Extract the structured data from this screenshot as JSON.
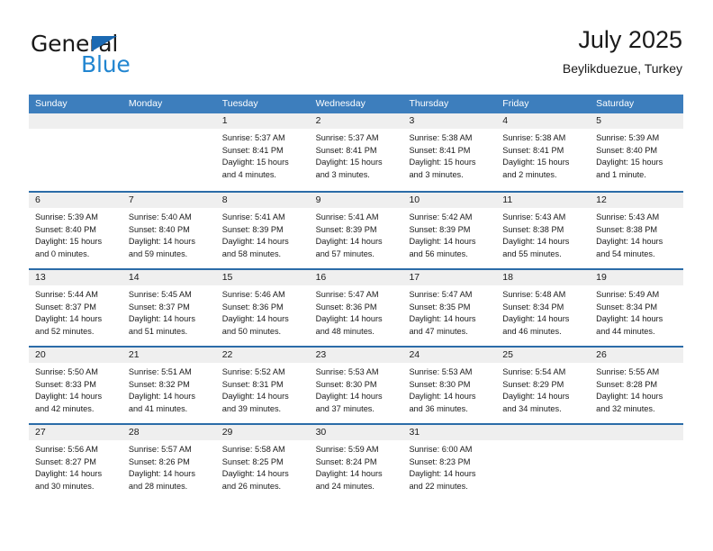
{
  "brand": {
    "name_part1": "General",
    "name_part2": "Blue",
    "accent_color": "#2185d0",
    "triangle_color": "#1b69b2"
  },
  "header": {
    "title": "July 2025",
    "subtitle": "Beylikduezue, Turkey"
  },
  "calendar": {
    "header_bg": "#3d7ebd",
    "row_divider": "#2b6ca8",
    "daynum_bg": "#efefef",
    "weekdays": [
      "Sunday",
      "Monday",
      "Tuesday",
      "Wednesday",
      "Thursday",
      "Friday",
      "Saturday"
    ],
    "weeks": [
      [
        {
          "day": "",
          "empty": true
        },
        {
          "day": "",
          "empty": true
        },
        {
          "day": "1",
          "sunrise": "Sunrise: 5:37 AM",
          "sunset": "Sunset: 8:41 PM",
          "daylight": "Daylight: 15 hours and 4 minutes."
        },
        {
          "day": "2",
          "sunrise": "Sunrise: 5:37 AM",
          "sunset": "Sunset: 8:41 PM",
          "daylight": "Daylight: 15 hours and 3 minutes."
        },
        {
          "day": "3",
          "sunrise": "Sunrise: 5:38 AM",
          "sunset": "Sunset: 8:41 PM",
          "daylight": "Daylight: 15 hours and 3 minutes."
        },
        {
          "day": "4",
          "sunrise": "Sunrise: 5:38 AM",
          "sunset": "Sunset: 8:41 PM",
          "daylight": "Daylight: 15 hours and 2 minutes."
        },
        {
          "day": "5",
          "sunrise": "Sunrise: 5:39 AM",
          "sunset": "Sunset: 8:40 PM",
          "daylight": "Daylight: 15 hours and 1 minute."
        }
      ],
      [
        {
          "day": "6",
          "sunrise": "Sunrise: 5:39 AM",
          "sunset": "Sunset: 8:40 PM",
          "daylight": "Daylight: 15 hours and 0 minutes."
        },
        {
          "day": "7",
          "sunrise": "Sunrise: 5:40 AM",
          "sunset": "Sunset: 8:40 PM",
          "daylight": "Daylight: 14 hours and 59 minutes."
        },
        {
          "day": "8",
          "sunrise": "Sunrise: 5:41 AM",
          "sunset": "Sunset: 8:39 PM",
          "daylight": "Daylight: 14 hours and 58 minutes."
        },
        {
          "day": "9",
          "sunrise": "Sunrise: 5:41 AM",
          "sunset": "Sunset: 8:39 PM",
          "daylight": "Daylight: 14 hours and 57 minutes."
        },
        {
          "day": "10",
          "sunrise": "Sunrise: 5:42 AM",
          "sunset": "Sunset: 8:39 PM",
          "daylight": "Daylight: 14 hours and 56 minutes."
        },
        {
          "day": "11",
          "sunrise": "Sunrise: 5:43 AM",
          "sunset": "Sunset: 8:38 PM",
          "daylight": "Daylight: 14 hours and 55 minutes."
        },
        {
          "day": "12",
          "sunrise": "Sunrise: 5:43 AM",
          "sunset": "Sunset: 8:38 PM",
          "daylight": "Daylight: 14 hours and 54 minutes."
        }
      ],
      [
        {
          "day": "13",
          "sunrise": "Sunrise: 5:44 AM",
          "sunset": "Sunset: 8:37 PM",
          "daylight": "Daylight: 14 hours and 52 minutes."
        },
        {
          "day": "14",
          "sunrise": "Sunrise: 5:45 AM",
          "sunset": "Sunset: 8:37 PM",
          "daylight": "Daylight: 14 hours and 51 minutes."
        },
        {
          "day": "15",
          "sunrise": "Sunrise: 5:46 AM",
          "sunset": "Sunset: 8:36 PM",
          "daylight": "Daylight: 14 hours and 50 minutes."
        },
        {
          "day": "16",
          "sunrise": "Sunrise: 5:47 AM",
          "sunset": "Sunset: 8:36 PM",
          "daylight": "Daylight: 14 hours and 48 minutes."
        },
        {
          "day": "17",
          "sunrise": "Sunrise: 5:47 AM",
          "sunset": "Sunset: 8:35 PM",
          "daylight": "Daylight: 14 hours and 47 minutes."
        },
        {
          "day": "18",
          "sunrise": "Sunrise: 5:48 AM",
          "sunset": "Sunset: 8:34 PM",
          "daylight": "Daylight: 14 hours and 46 minutes."
        },
        {
          "day": "19",
          "sunrise": "Sunrise: 5:49 AM",
          "sunset": "Sunset: 8:34 PM",
          "daylight": "Daylight: 14 hours and 44 minutes."
        }
      ],
      [
        {
          "day": "20",
          "sunrise": "Sunrise: 5:50 AM",
          "sunset": "Sunset: 8:33 PM",
          "daylight": "Daylight: 14 hours and 42 minutes."
        },
        {
          "day": "21",
          "sunrise": "Sunrise: 5:51 AM",
          "sunset": "Sunset: 8:32 PM",
          "daylight": "Daylight: 14 hours and 41 minutes."
        },
        {
          "day": "22",
          "sunrise": "Sunrise: 5:52 AM",
          "sunset": "Sunset: 8:31 PM",
          "daylight": "Daylight: 14 hours and 39 minutes."
        },
        {
          "day": "23",
          "sunrise": "Sunrise: 5:53 AM",
          "sunset": "Sunset: 8:30 PM",
          "daylight": "Daylight: 14 hours and 37 minutes."
        },
        {
          "day": "24",
          "sunrise": "Sunrise: 5:53 AM",
          "sunset": "Sunset: 8:30 PM",
          "daylight": "Daylight: 14 hours and 36 minutes."
        },
        {
          "day": "25",
          "sunrise": "Sunrise: 5:54 AM",
          "sunset": "Sunset: 8:29 PM",
          "daylight": "Daylight: 14 hours and 34 minutes."
        },
        {
          "day": "26",
          "sunrise": "Sunrise: 5:55 AM",
          "sunset": "Sunset: 8:28 PM",
          "daylight": "Daylight: 14 hours and 32 minutes."
        }
      ],
      [
        {
          "day": "27",
          "sunrise": "Sunrise: 5:56 AM",
          "sunset": "Sunset: 8:27 PM",
          "daylight": "Daylight: 14 hours and 30 minutes."
        },
        {
          "day": "28",
          "sunrise": "Sunrise: 5:57 AM",
          "sunset": "Sunset: 8:26 PM",
          "daylight": "Daylight: 14 hours and 28 minutes."
        },
        {
          "day": "29",
          "sunrise": "Sunrise: 5:58 AM",
          "sunset": "Sunset: 8:25 PM",
          "daylight": "Daylight: 14 hours and 26 minutes."
        },
        {
          "day": "30",
          "sunrise": "Sunrise: 5:59 AM",
          "sunset": "Sunset: 8:24 PM",
          "daylight": "Daylight: 14 hours and 24 minutes."
        },
        {
          "day": "31",
          "sunrise": "Sunrise: 6:00 AM",
          "sunset": "Sunset: 8:23 PM",
          "daylight": "Daylight: 14 hours and 22 minutes."
        },
        {
          "day": "",
          "empty": true
        },
        {
          "day": "",
          "empty": true
        }
      ]
    ]
  }
}
